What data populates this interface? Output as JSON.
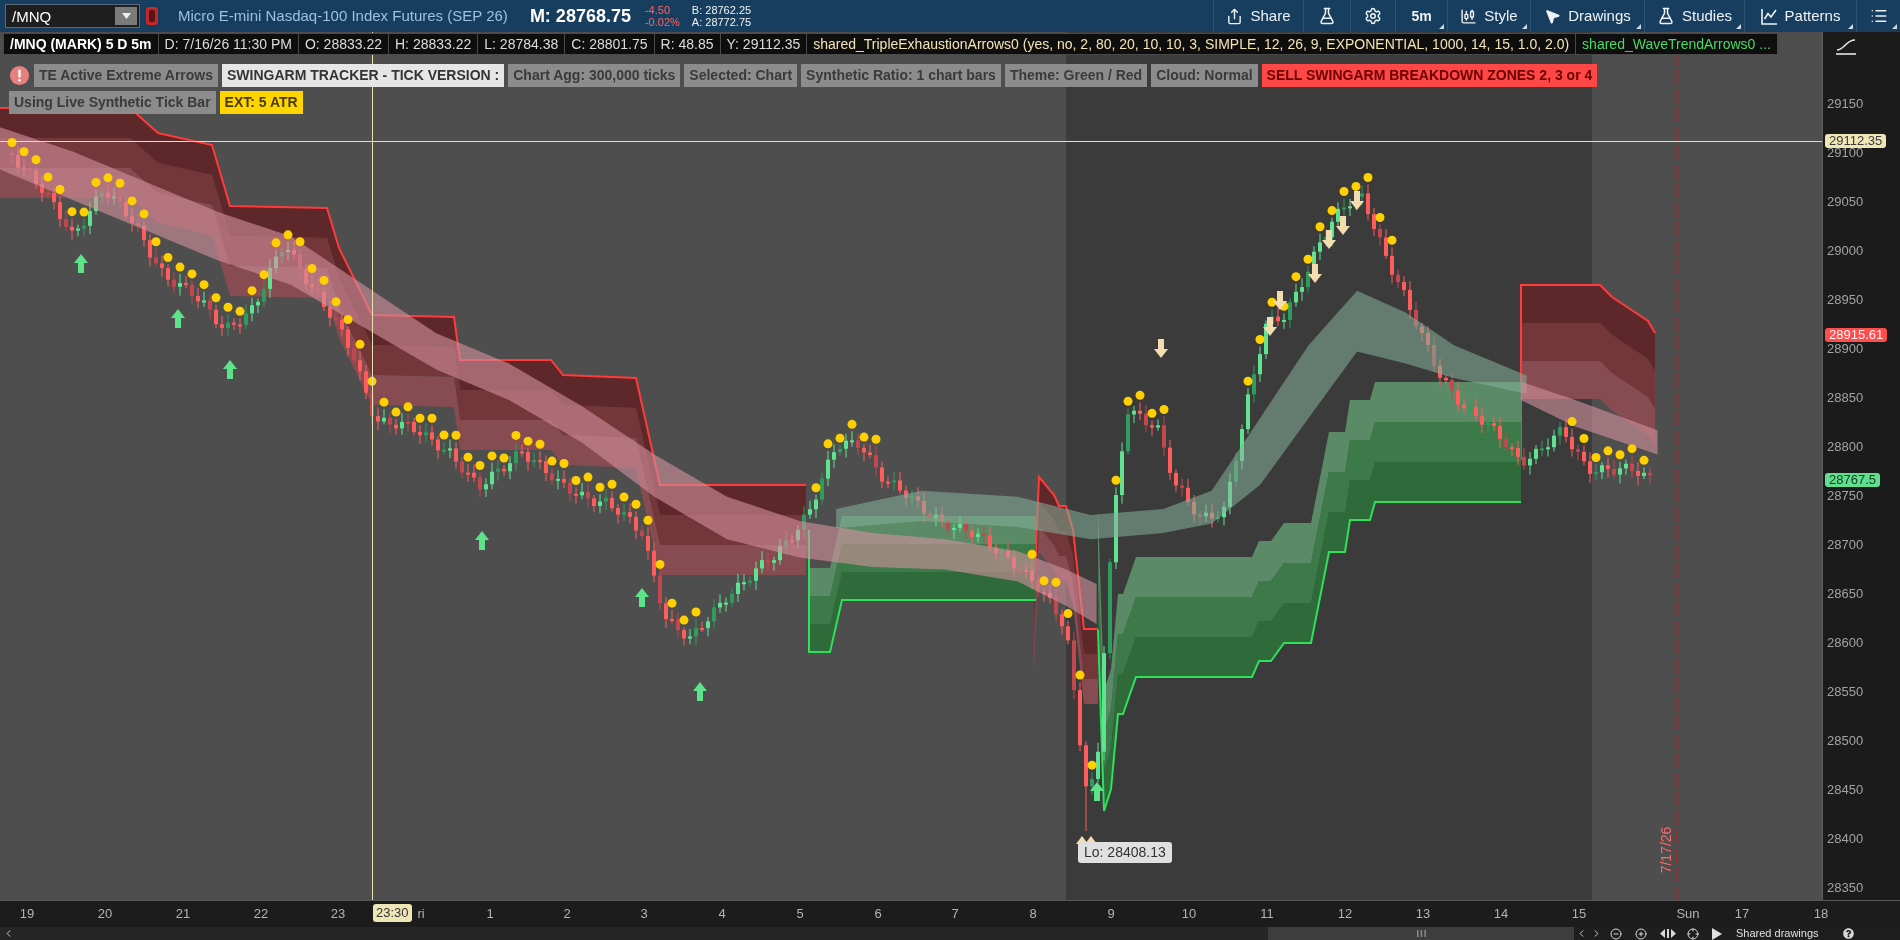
{
  "toolbar": {
    "symbol": "/MNQ",
    "description": "Micro E-mini Nasdaq-100 Index Futures (SEP 26)",
    "mark": "M: 28768.75",
    "net_change": "-4.50",
    "percent_change": "-0.02%",
    "bid": "B: 28762.25",
    "ask": "A: 28772.75",
    "buttons": [
      {
        "kind": "share",
        "label": "Share",
        "menu": false
      },
      {
        "kind": "flask",
        "menu": false
      },
      {
        "kind": "gear",
        "menu": false
      },
      {
        "kind": "interval",
        "label": "5m",
        "menu": true
      },
      {
        "kind": "style",
        "label": "Style",
        "menu": true
      },
      {
        "kind": "drawings",
        "label": "Drawings",
        "menu": true
      },
      {
        "kind": "studies",
        "label": "Studies",
        "menu": true
      },
      {
        "kind": "patterns",
        "label": "Patterns",
        "menu": true
      },
      {
        "kind": "list",
        "menu": true
      }
    ]
  },
  "info_bar": {
    "title": "/MNQ (MARK) 5 D 5m",
    "fields": [
      "D: 7/16/26 11:30 PM",
      "O: 28833.22",
      "H: 28833.22",
      "L: 28784.38",
      "C: 28801.75",
      "R: 48.85",
      "Y: 29112.35"
    ],
    "studies": [
      {
        "text": "shared_TripleExhaustionArrows0 (yes, no, 2, 80, 20, 10, 10, 3, SIMPLE, 12, 26, 9, EXPONENTIAL, 1000, 14, 15, 1.0, 2.0)",
        "kind": "exhaustion"
      },
      {
        "text": "shared_WaveTrendArrows0 ...",
        "kind": "wavetrend"
      }
    ]
  },
  "label_rows": [
    {
      "alert": true,
      "tags": [
        {
          "text": "TE Active Extreme Arrows",
          "kind": "neutral"
        },
        {
          "text": "SWINGARM TRACKER - TICK VERSION :",
          "kind": "title"
        },
        {
          "text": "Chart Agg: 300,000 ticks",
          "kind": "neutral"
        },
        {
          "text": "Selected: Chart",
          "kind": "neutral"
        },
        {
          "text": "Synthetic Ratio: 1 chart bars",
          "kind": "neutral"
        },
        {
          "text": "Theme: Green / Red",
          "kind": "neutral"
        },
        {
          "text": "Cloud: Normal",
          "kind": "neutral"
        },
        {
          "text": "SELL SWINGARM BREAKDOWN ZONES 2, 3 or 4",
          "kind": "sell"
        }
      ]
    },
    {
      "alert": false,
      "tags": [
        {
          "text": "Using Live Synthetic Tick Bar",
          "kind": "neutral"
        },
        {
          "text": "EXT: 5 ATR",
          "kind": "extension"
        }
      ]
    }
  ],
  "chart": {
    "low_label": "Lo: 28408.13",
    "expiration_label": "7/17/26"
  },
  "price_axis": {
    "ticks": [
      "29150",
      "29100",
      "29050",
      "29000",
      "28950",
      "28900",
      "28850",
      "28800",
      "28750",
      "28700",
      "28650",
      "28600",
      "28550",
      "28500",
      "28450",
      "28400",
      "28350"
    ],
    "badges": [
      {
        "text": "29112.35",
        "kind": "crosshair"
      },
      {
        "text": "28915.61",
        "kind": "resistance"
      },
      {
        "text": "28767.5",
        "kind": "support"
      }
    ]
  },
  "time_axis": {
    "labels": [
      "19",
      "20",
      "21",
      "22",
      "23",
      "ri",
      "1",
      "2",
      "3",
      "4",
      "5",
      "6",
      "7",
      "8",
      "9",
      "10",
      "11",
      "12",
      "13",
      "14",
      "15",
      "Sun",
      "17",
      "18"
    ],
    "cursor": "23:30"
  },
  "footer": {
    "shared_drawings": "Shared drawings"
  }
}
